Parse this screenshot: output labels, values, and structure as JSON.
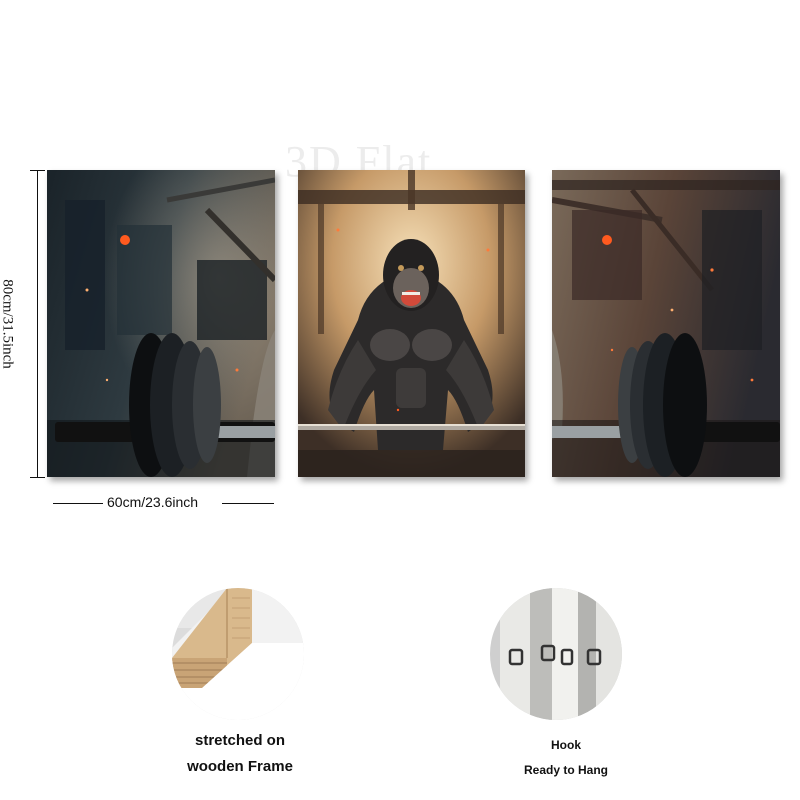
{
  "watermark": "3D Flat",
  "dimensions": {
    "height_label": "80cm/31.5inch",
    "width_label": "60cm/23.6inch"
  },
  "panels": [
    {
      "name": "left-panel",
      "subject": "gym barbell plates, dark industrial"
    },
    {
      "name": "center-panel",
      "subject": "roaring gorilla lifting barbell"
    },
    {
      "name": "right-panel",
      "subject": "gym barbell plates with sparks"
    }
  ],
  "details": {
    "frame": {
      "line1": "stretched on",
      "line2": "wooden Frame"
    },
    "hook": {
      "line1": "Hook",
      "line2": "Ready to Hang"
    }
  },
  "colors": {
    "background": "#ffffff",
    "dark_steel": "#1e2830",
    "warm_glow": "#e8c79a",
    "spark": "#ff6a1a"
  }
}
